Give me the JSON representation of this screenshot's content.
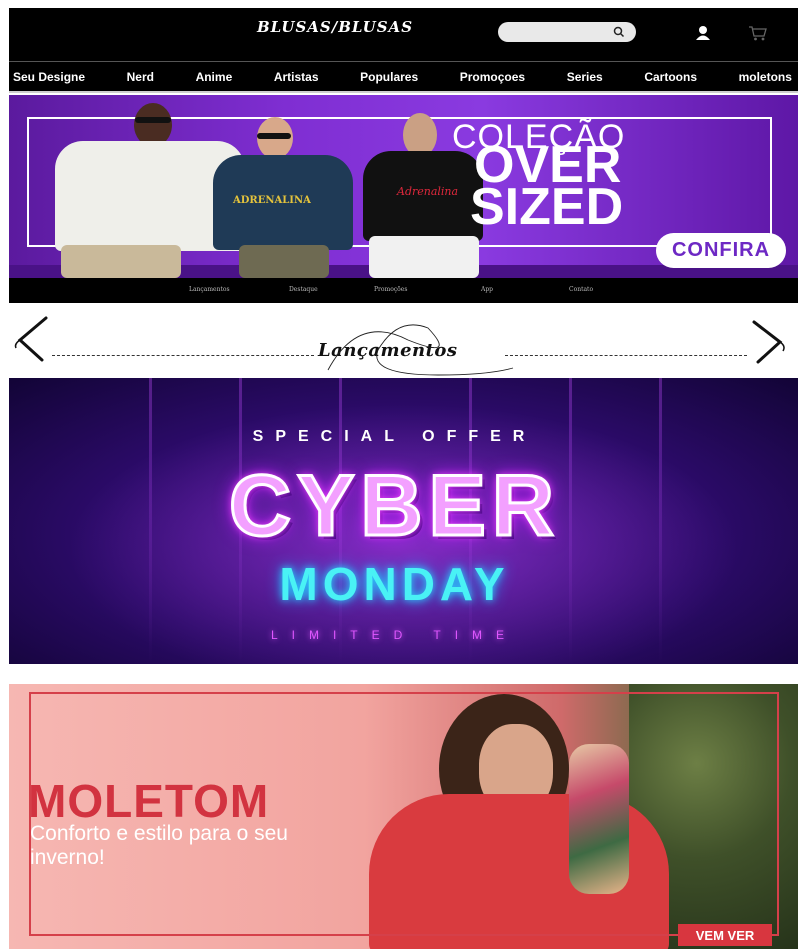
{
  "header": {
    "logo": "BLUSAS/BLUSAS",
    "search_placeholder": "",
    "icons": [
      "search-icon",
      "user-icon",
      "cart-icon"
    ]
  },
  "nav": {
    "items": [
      "Seu Designe",
      "Nerd",
      "Anime",
      "Artistas",
      "Populares",
      "Promoçoes",
      "Series",
      "Cartoons",
      "moletons"
    ]
  },
  "hero": {
    "title_line1": "COLEÇÃO",
    "title_line2": "OVER",
    "title_line3": "SIZED",
    "cta": "CONFIRA",
    "tee_prints": [
      "ADRENALINA",
      "Adrenalina"
    ]
  },
  "subnav": {
    "items": [
      "Lançamentos",
      "Destaque",
      "Promoções",
      "App",
      "Contato"
    ]
  },
  "section": {
    "title": "Lançamentos",
    "icons": [
      "chevron-left-icon",
      "chevron-right-icon"
    ]
  },
  "cyber_banner": {
    "line1": "SPECIAL OFFER",
    "line2": "CYBER",
    "line3": "MONDAY",
    "line4": "LIMITED TIME"
  },
  "moletom_banner": {
    "title": "MOLETOM",
    "subtitle": "Conforto e estilo para o seu inverno!",
    "cta": "VEM VER"
  },
  "colors": {
    "header_bg": "#000000",
    "hero_purple": "#7f2ed2",
    "cyber_cyan": "#49f2f5",
    "moletom_red": "#d23340"
  }
}
